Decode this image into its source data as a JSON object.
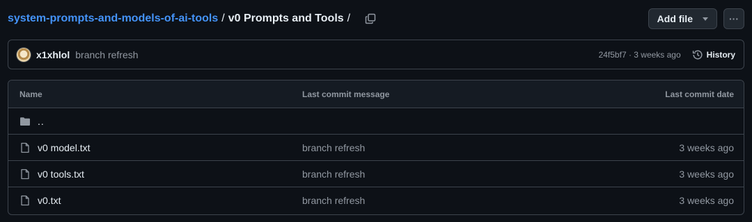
{
  "breadcrumb": {
    "repo": "system-prompts-and-models-of-ai-tools",
    "separator": "/",
    "current": "v0 Prompts and Tools",
    "trailing_separator": "/"
  },
  "toolbar": {
    "add_file_label": "Add file",
    "more_label": "···"
  },
  "commit": {
    "author": "x1xhlol",
    "message": "branch refresh",
    "sha_and_time": "24f5bf7 · 3 weeks ago",
    "history_label": "History"
  },
  "table": {
    "headers": [
      "Name",
      "Last commit message",
      "Last commit date"
    ],
    "parent_dir": "..",
    "rows": [
      {
        "name": "v0 model.txt",
        "message": "branch refresh",
        "date": "3 weeks ago"
      },
      {
        "name": "v0 tools.txt",
        "message": "branch refresh",
        "date": "3 weeks ago"
      },
      {
        "name": "v0.txt",
        "message": "branch refresh",
        "date": "3 weeks ago"
      }
    ]
  },
  "icons": {
    "copy": "copy-icon",
    "history": "history-icon",
    "folder": "folder-icon",
    "file": "file-icon",
    "caret": "caret-down-icon"
  },
  "colors": {
    "background": "#0d1117",
    "link": "#4493f8",
    "border": "#3d444d",
    "muted": "#9198a1"
  }
}
